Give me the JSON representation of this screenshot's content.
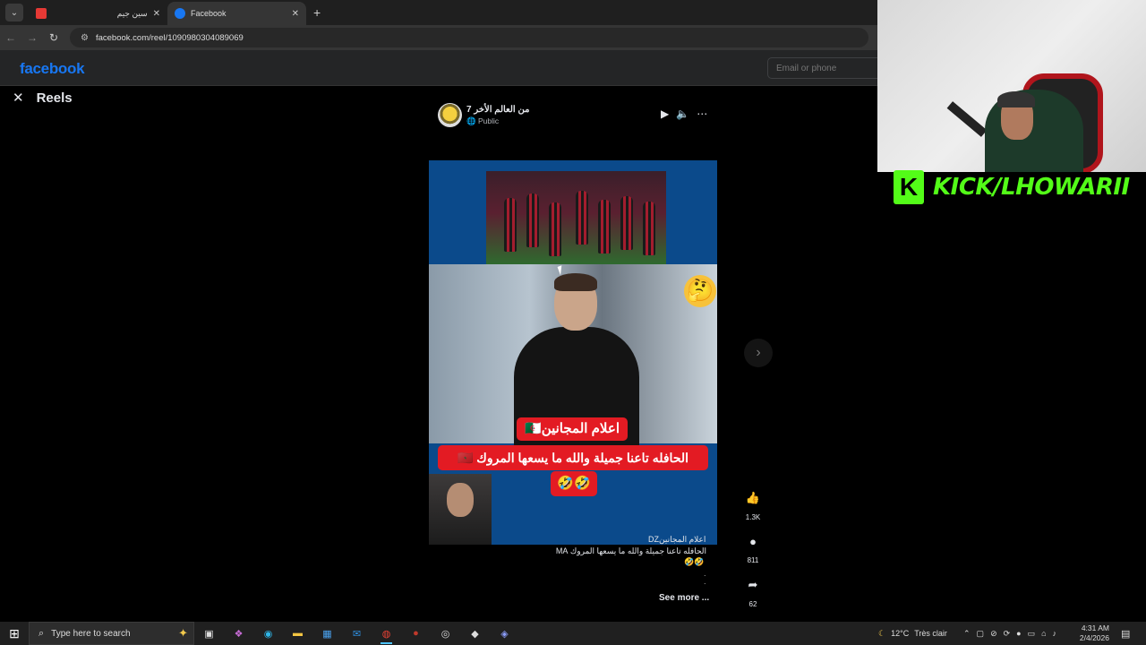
{
  "browser": {
    "tabs": [
      {
        "title": "سين جيم",
        "favicon_color": "#e53935",
        "active": false
      },
      {
        "title": "Facebook",
        "favicon_color": "#1877f2",
        "active": true
      }
    ],
    "url": "facebook.com/reel/1090980304089069"
  },
  "facebook": {
    "logo": "facebook",
    "email_placeholder": "Email or phone",
    "reels_title": "Reels",
    "post": {
      "author": "من العالم الأخر 7",
      "visibility": "Public",
      "video_captions": {
        "line1": "اعلام المجانين🇩🇿",
        "line2": "الحافله تاعنا جميلة والله ما يسعها المروك 🇲🇦",
        "line3": "🤣🤣"
      },
      "caption_author": "اعلام المجانينDZ",
      "caption_text": "الحافله تاعنا جميلة والله ما يسعها المروك MA",
      "caption_emoji": "🤣🤣",
      "see_more": "See more ...",
      "likes": "1.3K",
      "comments": "811",
      "shares": "62"
    }
  },
  "stream": {
    "kick_label": "KICK/LHOWARII",
    "kick_color": "#53fc18"
  },
  "taskbar": {
    "search_placeholder": "Type here to search",
    "weather_temp": "12°C",
    "weather_desc": "Très clair",
    "time": "4:31 AM",
    "date": "2/4/2026"
  }
}
